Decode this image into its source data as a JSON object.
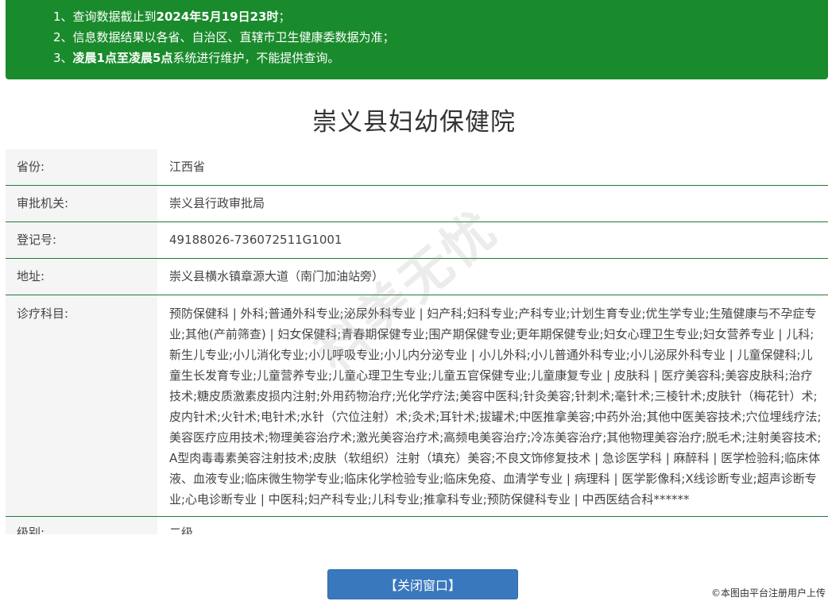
{
  "notice": {
    "line1_prefix": "1、查询数据截止到",
    "line1_bold": "2024年5月19日23时",
    "line1_suffix": "；",
    "line2": "2、信息数据结果以各省、自治区、直辖市卫生健康委数据为准；",
    "line3_prefix": "3、",
    "line3_bold": "凌晨1点至凌晨5点",
    "line3_suffix": "系统进行维护，不能提供查询。",
    "color": "#1a8b2c"
  },
  "page_title": "崇义县妇幼保健院",
  "fields": {
    "province": {
      "label": "省份:",
      "value": "江西省"
    },
    "authority": {
      "label": "审批机关:",
      "value": "崇义县行政审批局"
    },
    "reg_no": {
      "label": "登记号:",
      "value": "49188026-736072511G1001"
    },
    "address": {
      "label": "地址:",
      "value": "崇义县横水镇章源大道（南门加油站旁）"
    },
    "departments": {
      "label": "诊疗科目:",
      "value": "预防保健科 | 外科;普通外科专业;泌尿外科专业 | 妇产科;妇科专业;产科专业;计划生育专业;优生学专业;生殖健康与不孕症专业;其他(产前筛查) | 妇女保健科;青春期保健专业;围产期保健专业;更年期保健专业;妇女心理卫生专业;妇女营养专业 | 儿科;新生儿专业;小儿消化专业;小儿呼吸专业;小儿内分泌专业 | 小儿外科;小儿普通外科专业;小儿泌尿外科专业 | 儿童保健科;儿童生长发育专业;儿童营养专业;儿童心理卫生专业;儿童五官保健专业;儿童康复专业 | 皮肤科 | 医疗美容科;美容皮肤科;治疗技术;糖皮质激素皮损内注射;外用药物治疗;光化学疗法;美容中医科;针灸美容;针刺术;毫针术;三棱针术;皮肤针（梅花针）术;皮内针术;火针术;电针术;水针（穴位注射）术;灸术;耳针术;拔罐术;中医推拿美容;中药外治;其他中医美容技术;穴位埋线疗法;美容医疗应用技术;物理美容治疗术;激光美容治疗术;高频电美容治疗;冷冻美容治疗;其他物理美容治疗;脱毛术;注射美容技术;A型肉毒毒素美容注射技术;皮肤（软组织）注射（填充）美容;不良文饰修复技术 | 急诊医学科 | 麻醉科 | 医学检验科;临床体液、血液专业;临床微生物学专业;临床化学检验专业;临床免疫、血清学专业 | 病理科 | 医学影像科;X线诊断专业;超声诊断专业;心电诊断专业 | 中医科;妇产科专业;儿科专业;推拿科专业;预防保健科专业 | 中西医结合科******"
    },
    "level": {
      "label": "级别:",
      "value": "二级"
    }
  },
  "close_button": "【关闭窗口】",
  "copyright": "©本图由平台注册用户上传",
  "watermark": "科美无忧"
}
